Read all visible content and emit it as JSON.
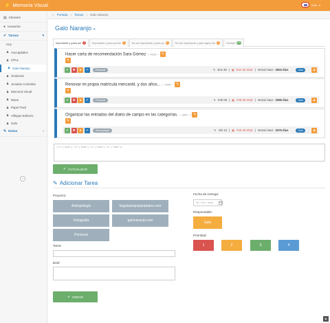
{
  "app": {
    "title": "Memoria Visual",
    "user_label": "Hola"
  },
  "sidebar": {
    "items": [
      {
        "label": "Clientes",
        "icon": "clipboard-icon"
      },
      {
        "label": "Usuarios",
        "icon": "users-icon"
      }
    ],
    "tareas_label": "Tareas",
    "tareas_sub": [
      "Hoy",
      "Asocapitales",
      "CPAL",
      "Galo Naranjo",
      "Gestionar",
      "Jesuitas Colombia",
      "Memoria Visual",
      "Murai",
      "Papel Pack",
      "Villegas Editores",
      "Galo"
    ],
    "notas_label": "Notas"
  },
  "breadcrumb": {
    "home": "Portada",
    "section": "Tareas",
    "current": "Galo Naranjo"
  },
  "page": {
    "title": "Galo Naranjo",
    "title_suffix": "»"
  },
  "tabs": [
    {
      "label": "Importante y ¡para ya!",
      "badge": "3",
      "badge_color": "#d9534f"
    },
    {
      "label": "Importante y para pronto",
      "badge": "0",
      "badge_color": "#f39c3c"
    },
    {
      "label": "No tan importante y para ya",
      "badge": "0",
      "badge_color": "#f39c3c"
    },
    {
      "label": "No tan importante y para algún día",
      "badge": "0",
      "badge_color": "#f39c3c"
    },
    {
      "label": "Hechas",
      "badge": "117",
      "badge_color": "#6cae6c"
    }
  ],
  "tasks": [
    {
      "title": "Hacer carta de recomendación Sara Gómez",
      "id": "— 4135 —",
      "tag": "Personal",
      "created": "Ene 30",
      "due": "Ene 30 2018",
      "expired": "Vencio hace",
      "days": "2604 días",
      "assignee": "Galo"
    },
    {
      "title": "Renovar mi propia matrícula mercantil, y dos años...",
      "id": "— 4195 —",
      "tag": "Personal",
      "created": "Feb 05",
      "due": "Feb 05 2018",
      "expired": "Vencio hace",
      "days": "2598 días",
      "assignee": "Galo"
    },
    {
      "title": "Organizar las entradas del diario de campo en las categorías.",
      "id": "— 3997 —",
      "tag": "Antropología",
      "created": "Abr 12",
      "due": "Feb 28 2018",
      "expired": "Vencio hace",
      "days": "2575 días",
      "assignee": "Galo"
    }
  ],
  "json_text": "{\"2\":[\"4211\"],\"3\":[\"4195\"],\"3\":[\"4165\"],\"4\":[\"3997\"]}",
  "update_label": "ACTUALIZAR",
  "form": {
    "section_title": "Adicionar Tarea",
    "project_label": "Proyecto:",
    "projects": [
      "Antropología",
      "bogotamejorparatodos.com",
      "Fotografía",
      "galonaranjo.com",
      "Personal"
    ],
    "task_label": "Tarea:",
    "brief_label": "Brief:",
    "create_label": "CREAR",
    "date_label": "Fecha de entrega:",
    "date_placeholder": "dd / mm / aaaa",
    "responsable_label": "Responsable:",
    "responsable_value": "Galo",
    "priority_label": "Prioridad:",
    "priorities": [
      {
        "label": "1",
        "color": "#d9534f"
      },
      {
        "label": "2",
        "color": "#f5ad40"
      },
      {
        "label": "3",
        "color": "#6cae6c"
      },
      {
        "label": "4",
        "color": "#5b9bd5"
      }
    ]
  }
}
